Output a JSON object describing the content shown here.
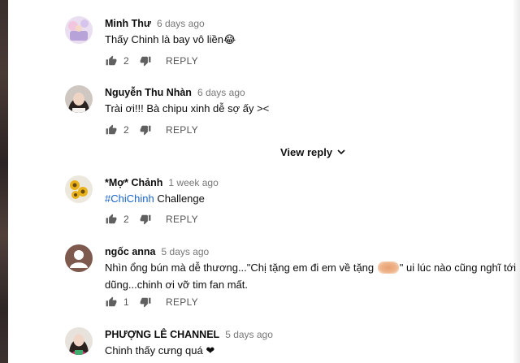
{
  "comments": [
    {
      "author": "Minh Thư",
      "time": "6 days ago",
      "text": "Thấy Chinh là bay vô liền😂",
      "likes": "2",
      "reply_label": "REPLY"
    },
    {
      "author": "Nguyễn Thu Nhàn",
      "time": "6 days ago",
      "text": "Trài ơi!!! Bà chipu xinh dễ sợ ấy ><",
      "likes": "2",
      "reply_label": "REPLY"
    },
    {
      "author": "*Mợ* Chảnh",
      "time": "1 week ago",
      "hashtag": "#ChiChinh",
      "text": " Challenge",
      "likes": "2",
      "reply_label": "REPLY"
    },
    {
      "author": "ngốc anna",
      "time": "5 days ago",
      "text_before": "Nhìn ổng bún mà dễ thương...\"Chị tặng em đi em về tặng ",
      "text_after": "\" ui lúc nào cũng nghĩ tới dũng...chinh ơi vỡ tim fan mất.",
      "likes": "1",
      "reply_label": "REPLY"
    },
    {
      "author": "PHƯỢNG LÊ CHANNEL",
      "time": "5 days ago",
      "text": "Chinh thấy cưng quá ❤"
    }
  ],
  "view_reply": {
    "label": "View reply"
  },
  "colors": {
    "hashtag": "#1864c9",
    "meta": "#777777",
    "action": "#555555"
  }
}
